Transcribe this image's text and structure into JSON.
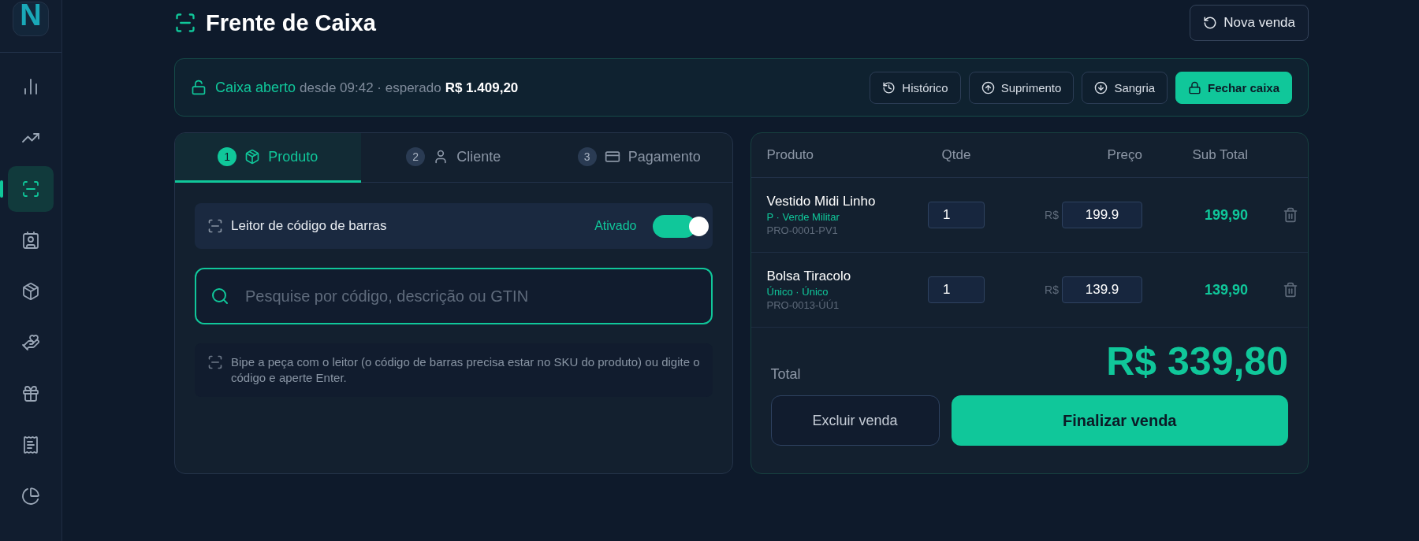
{
  "logo": "N",
  "sidebar": {
    "items": [
      {
        "selected": false
      },
      {
        "selected": false
      },
      {
        "selected": true
      },
      {
        "selected": false
      },
      {
        "selected": false
      },
      {
        "selected": false
      },
      {
        "selected": false
      },
      {
        "selected": false
      },
      {
        "selected": false
      }
    ]
  },
  "header": {
    "title": "Frente de Caixa",
    "new_sale_button": "Nova venda"
  },
  "cash_bar": {
    "status": "Caixa aberto",
    "open": true,
    "since": "desde 09:42 · esperado",
    "expected": "R$ 1.409,20",
    "actions": [
      {
        "kind": "history",
        "label": "Histórico",
        "primary": false
      },
      {
        "kind": "supply",
        "label": "Suprimento",
        "primary": false
      },
      {
        "kind": "withdraw",
        "label": "Sangria",
        "primary": false
      },
      {
        "kind": "close",
        "label": "Fechar caixa",
        "primary": true
      }
    ]
  },
  "steps": [
    {
      "number": "1",
      "kind": "product",
      "label": "Produto",
      "selected": true
    },
    {
      "number": "2",
      "kind": "client",
      "label": "Cliente",
      "selected": false
    },
    {
      "number": "3",
      "kind": "payment",
      "label": "Pagamento",
      "selected": false
    }
  ],
  "scanner": {
    "label": "Leitor de código de barras",
    "state_label": "Ativado",
    "on": true
  },
  "search": {
    "placeholder": "Pesquise por código, descrição ou GTIN"
  },
  "hint": "Bipe a peça com o leitor (o código de barras precisa estar no SKU do produto) ou digite o código e aperte Enter.",
  "cart": {
    "columns": [
      "Produto",
      "Qtde",
      "Preço",
      "Sub Total"
    ],
    "rows": [
      {
        "name": "Vestido Midi Linho",
        "variant": "P · Verde Militar",
        "sku": "PRO-0001-PV1",
        "qty": "1",
        "currency": "R$",
        "price": "199.9",
        "subtotal": "199,90"
      },
      {
        "name": "Bolsa Tiracolo",
        "variant": "Único · Único",
        "sku": "PRO-0013-ÚÚ1",
        "qty": "1",
        "currency": "R$",
        "price": "139.9",
        "subtotal": "139,90"
      }
    ],
    "total_label": "Total",
    "total": "R$ 339,80",
    "delete_button": "Excluir venda",
    "finish_button": "Finalizar venda"
  }
}
